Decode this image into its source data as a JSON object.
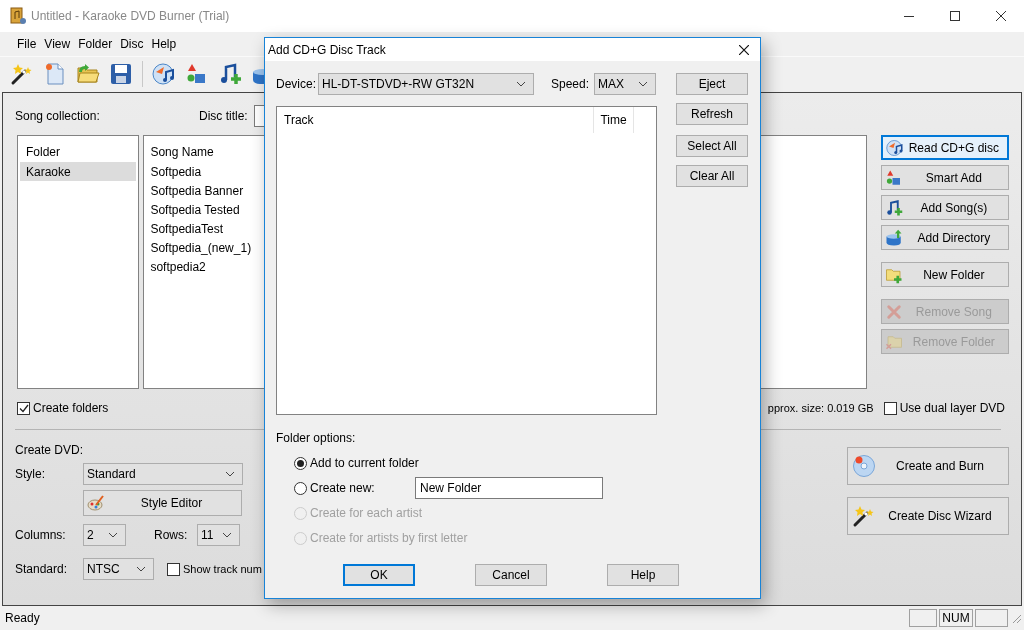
{
  "window": {
    "title": "Untitled - Karaoke DVD Burner (Trial)"
  },
  "menu": [
    "File",
    "View",
    "Folder",
    "Disc",
    "Help"
  ],
  "collection": {
    "label": "Song collection:",
    "disc_title_label": "Disc title:"
  },
  "folders": {
    "header": "Folder",
    "items": [
      {
        "name": "Karaoke",
        "selected": true
      }
    ]
  },
  "songs": {
    "header": "Song Name",
    "items": [
      "Softpedia",
      "Softpedia Banner",
      "Softpedia Tested",
      "SoftpediaTest",
      "Softpedia_(new_1)",
      "softpedia2"
    ]
  },
  "side_buttons": [
    [
      {
        "label": "Read CD+G disc",
        "disabled": false,
        "focused": true
      },
      {
        "label": "Smart Add",
        "disabled": false,
        "focused": false
      },
      {
        "label": "Add Song(s)",
        "disabled": false,
        "focused": false
      },
      {
        "label": "Add Directory",
        "disabled": false,
        "focused": false
      }
    ],
    [
      {
        "label": "New Folder",
        "disabled": false,
        "focused": false
      }
    ],
    [
      {
        "label": "Remove Song",
        "disabled": true,
        "focused": false
      },
      {
        "label": "Remove Folder",
        "disabled": true,
        "focused": false
      }
    ]
  ],
  "create_folders": {
    "label": "Create folders",
    "checked": true
  },
  "approx_size": "pprox. size: 0.019 GB",
  "dual_layer": {
    "label": "Use dual layer DVD",
    "checked": false
  },
  "create_dvd": {
    "label": "Create DVD:",
    "style_label": "Style:",
    "style": "Standard",
    "style_editor": "Style Editor",
    "columns_label": "Columns:",
    "columns": "2",
    "rows_label": "Rows:",
    "rows": "11",
    "standard_label": "Standard:",
    "standard": "NTSC",
    "show_track": {
      "label": "Show track num",
      "checked": false
    }
  },
  "action_buttons": [
    "Create and Burn",
    "Create Disc Wizard"
  ],
  "status_bar": {
    "text": "Ready",
    "num": "NUM"
  },
  "dialog": {
    "title": "Add CD+G Disc Track",
    "device_label": "Device:",
    "device": "HL-DT-STDVD+-RW GT32N",
    "speed_label": "Speed:",
    "speed": "MAX",
    "columns": [
      "Track",
      "Time"
    ],
    "buttons": [
      "Eject",
      "Refresh",
      "Select All",
      "Clear All"
    ],
    "folder_options_label": "Folder options:",
    "options": [
      {
        "label": "Add to current folder",
        "selected": true,
        "disabled": false
      },
      {
        "label": "Create new:",
        "selected": false,
        "disabled": false,
        "value": "New Folder"
      },
      {
        "label": "Create for each artist",
        "selected": false,
        "disabled": true
      },
      {
        "label": "Create for artists by first letter",
        "selected": false,
        "disabled": true
      }
    ],
    "footer_buttons": [
      {
        "label": "OK",
        "default": true
      },
      {
        "label": "Cancel",
        "default": false
      },
      {
        "label": "Help",
        "default": false
      }
    ]
  }
}
